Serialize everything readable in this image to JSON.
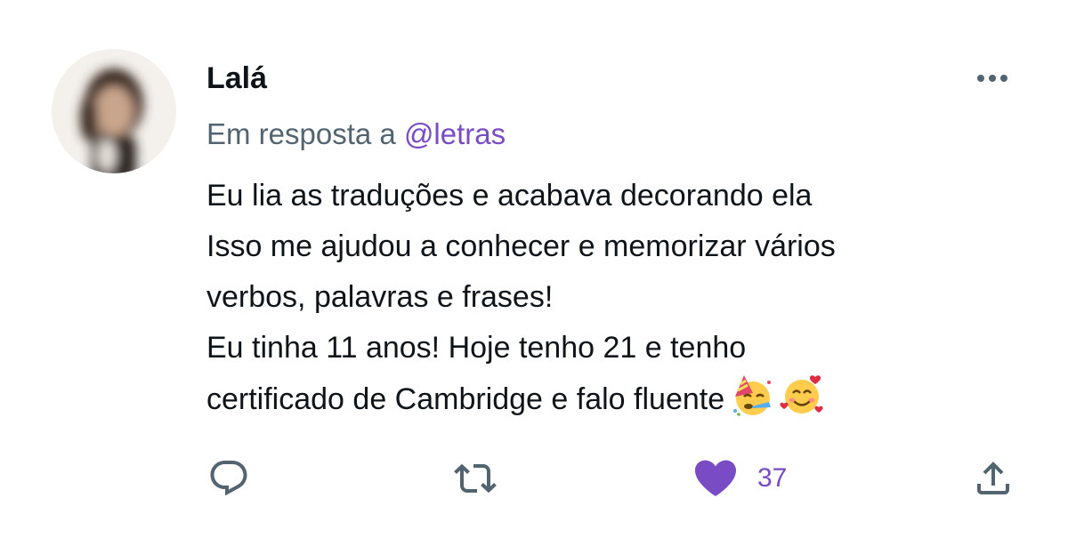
{
  "tweet": {
    "author_name": "Lalá",
    "reply_prefix": "Em resposta a",
    "reply_handle": "@letras",
    "text_lines": [
      "Eu lia as traduções e acabava decorando ela",
      "Isso me ajudou a conhecer e memorizar vários",
      "verbos, palavras e frases!",
      "Eu tinha 11 anos! Hoje tenho 21 e tenho",
      "certificado de Cambridge e falo fluente"
    ],
    "emojis": [
      "partying-face",
      "smiling-face-with-hearts"
    ],
    "like_count": "37",
    "liked": true
  },
  "colors": {
    "text": "#0f1419",
    "secondary": "#536471",
    "accent": "#794bc4"
  },
  "icons": {
    "more": "more-horizontal-icon",
    "reply": "reply-icon",
    "retweet": "retweet-icon",
    "like": "heart-icon",
    "share": "share-icon"
  }
}
